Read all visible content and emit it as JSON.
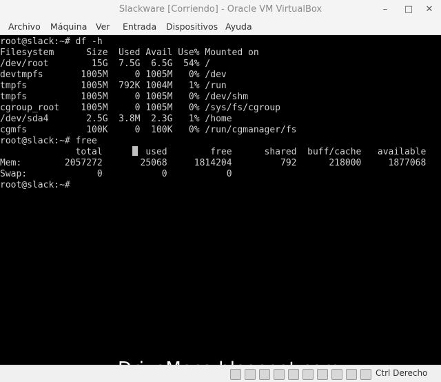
{
  "window": {
    "title": "Slackware [Corriendo] - Oracle VM VirtualBox",
    "minimize": "–",
    "maximize": "□",
    "close": "✕"
  },
  "menu": [
    "Archivo",
    "Máquina",
    "Ver",
    "Entrada",
    "Dispositivos",
    "Ayuda"
  ],
  "terminal": {
    "lines": [
      "root@slack:~# df -h",
      "Filesystem      Size  Used Avail Use% Mounted on",
      "/dev/root        15G  7.5G  6.5G  54% /",
      "devtmpfs       1005M     0 1005M   0% /dev",
      "tmpfs          1005M  792K 1004M   1% /run",
      "tmpfs          1005M     0 1005M   0% /dev/shm",
      "cgroup_root    1005M     0 1005M   0% /sys/fs/cgroup",
      "/dev/sda4       2.5G  3.8M  2.3G   1% /home",
      "cgmfs           100K     0  100K   0% /run/cgmanager/fs",
      "root@slack:~# free",
      "              total        used        free      shared  buff/cache   available",
      "Mem:        2057272       25068     1814204         792      218000     1877068",
      "Swap:             0           0           0",
      "root@slack:~#"
    ]
  },
  "watermark": "DriveMeca.blogspot.com",
  "statusbar": {
    "host_key": "Ctrl Derecho",
    "icons": [
      "hard-disk-icon",
      "optical-drive-icon",
      "audio-icon",
      "network-icon",
      "usb-icon",
      "shared-folders-icon",
      "display-icon",
      "video-capture-icon",
      "mouse-integration-icon",
      "host-key-icon"
    ]
  }
}
